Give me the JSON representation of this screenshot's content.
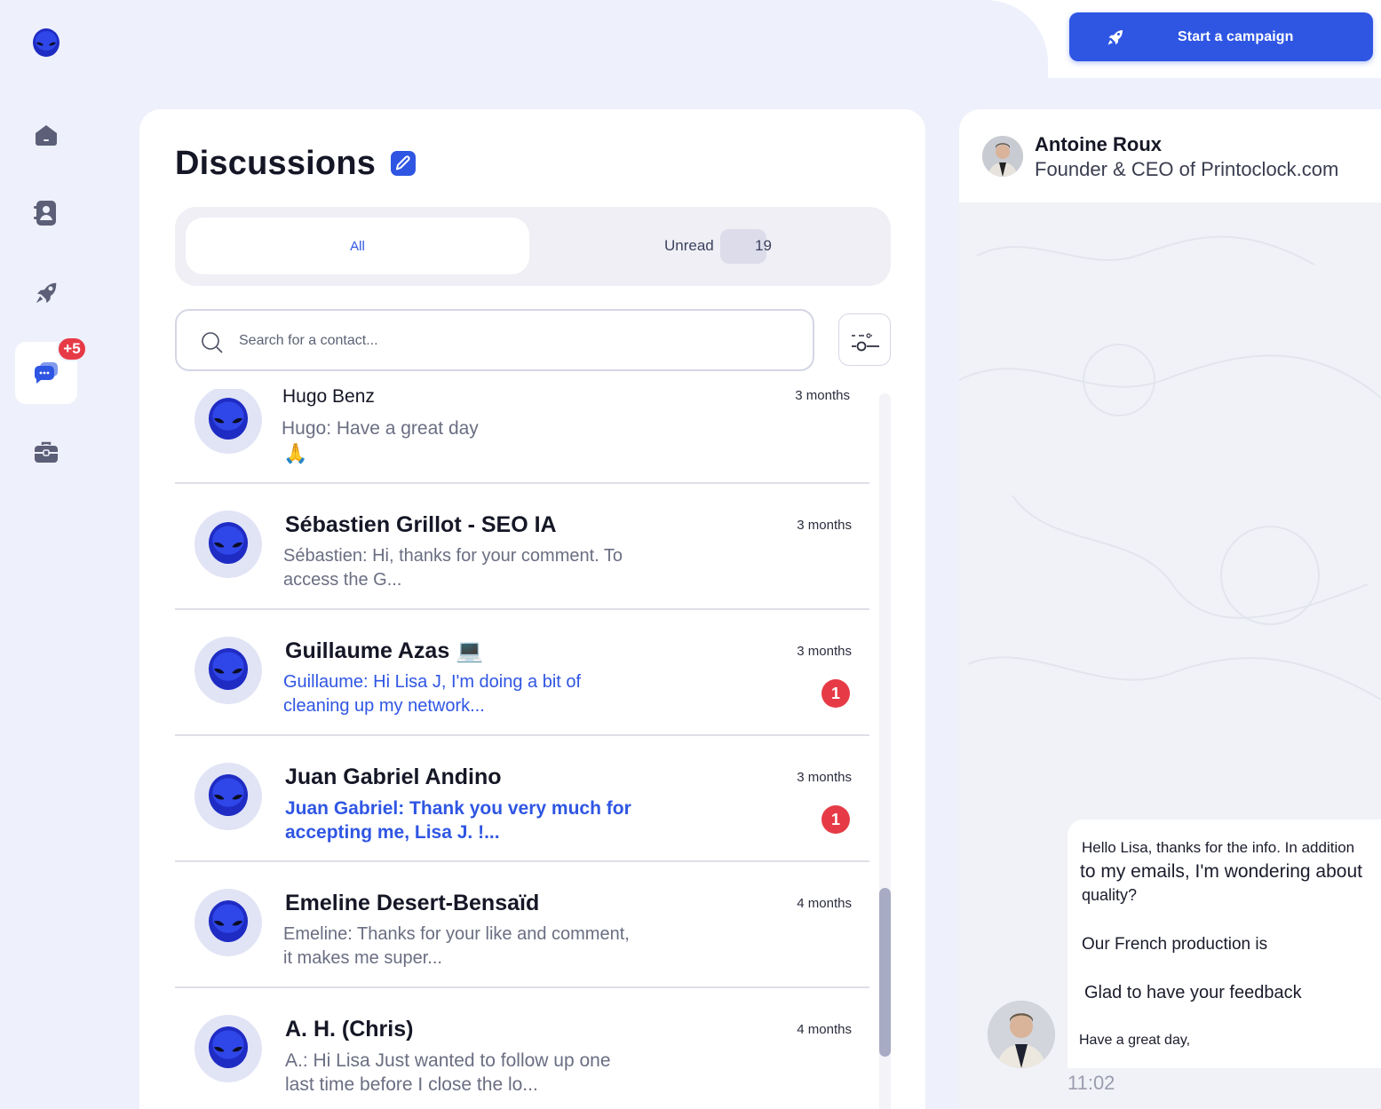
{
  "header": {
    "campaign_label": "Start a campaign"
  },
  "sidebar": {
    "items": [
      {
        "icon": "home-icon"
      },
      {
        "icon": "contacts-icon"
      },
      {
        "icon": "rocket-icon"
      },
      {
        "icon": "messages-icon",
        "badge": "+5",
        "active": true
      },
      {
        "icon": "briefcase-icon"
      }
    ]
  },
  "discussions": {
    "title": "Discussions",
    "tabs": {
      "all": "All",
      "unread": "Unread",
      "unread_count": "19"
    },
    "search_placeholder": "Search for a contact...",
    "conversations": [
      {
        "name": "Hugo Benz",
        "time": "3 months",
        "message": "Hugo: Have a great day",
        "emoji": "🙏",
        "unread": false,
        "badge": ""
      },
      {
        "name": "Sébastien Grillot - SEO IA",
        "time": "3 months",
        "message": "Sébastien: Hi, thanks for your comment. To access the G...",
        "unread": false,
        "badge": ""
      },
      {
        "name": "Guillaume Azas 💻",
        "time": "3 months",
        "message": "Guillaume: Hi Lisa J, I'm doing a bit of cleaning up my network...",
        "unread": true,
        "badge": "1"
      },
      {
        "name": "Juan Gabriel Andino",
        "time": "3 months",
        "message": "Juan Gabriel: Thank you very much for accepting me, Lisa J. !...",
        "unread": true,
        "badge": "1"
      },
      {
        "name": "Emeline Desert-Bensaïd",
        "time": "4 months",
        "message": "Emeline: Thanks for your like and comment, it makes me super...",
        "unread": false,
        "badge": ""
      },
      {
        "name": "A. H. (Chris)",
        "time": "4 months",
        "message": "A.: Hi Lisa  Just wanted to follow up one last time before I close the lo...",
        "unread": false,
        "badge": ""
      }
    ]
  },
  "chat": {
    "contact_name": "Antoine Roux",
    "contact_role": "Founder & CEO of Printoclock.com",
    "message_lines": [
      "Hello Lisa, thanks for the info. In addition",
      "to my emails, I'm wondering about",
      "quality?",
      "Our French production is",
      "Glad to have your feedback",
      "Have a great day,"
    ],
    "time": "11:02"
  },
  "colors": {
    "accent": "#2f56e3",
    "badge": "#e63b46",
    "background": "#eef0fb"
  }
}
